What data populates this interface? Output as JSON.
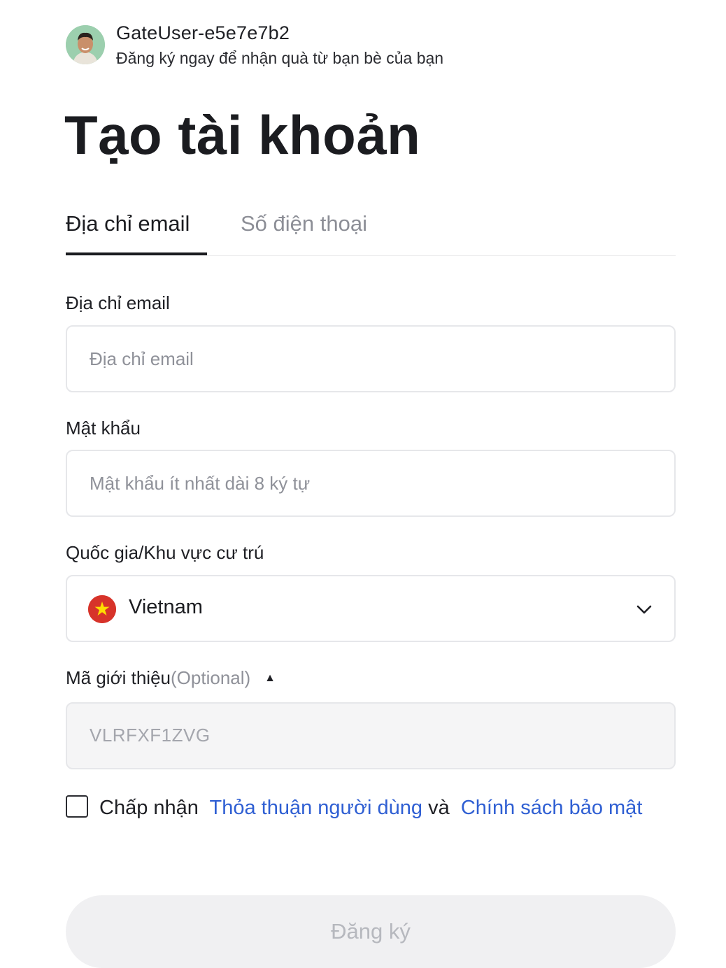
{
  "inviter": {
    "name": "GateUser-e5e7e7b2",
    "subtitle": "Đăng ký ngay để nhận quà từ bạn bè của bạn"
  },
  "title": "Tạo tài khoản",
  "tabs": [
    {
      "label": "Địa chỉ email",
      "active": true
    },
    {
      "label": "Số điện thoại",
      "active": false
    }
  ],
  "email": {
    "label": "Địa chỉ email",
    "placeholder": "Địa chỉ email",
    "value": ""
  },
  "password": {
    "label": "Mật khẩu",
    "placeholder": "Mật khẩu ít nhất dài 8 ký tự",
    "value": ""
  },
  "country": {
    "label": "Quốc gia/Khu vực cư trú",
    "selected": "Vietnam",
    "flag_icon": "vietnam-flag-icon"
  },
  "referral": {
    "label": "Mã giới thiệu",
    "optional": "(Optional)",
    "value": "VLRFXF1ZVG",
    "expanded": true
  },
  "agreement": {
    "checked": false,
    "prefix": "Chấp nhận",
    "terms_link": "Thỏa thuận người dùng",
    "conjunction": "và",
    "privacy_link": "Chính sách bảo mật"
  },
  "submit_label": "Đăng ký",
  "colors": {
    "link": "#2f5fd3",
    "text": "#1f2025",
    "muted": "#8f9199",
    "flag_red": "#d7332a",
    "flag_star": "#ffde00"
  }
}
